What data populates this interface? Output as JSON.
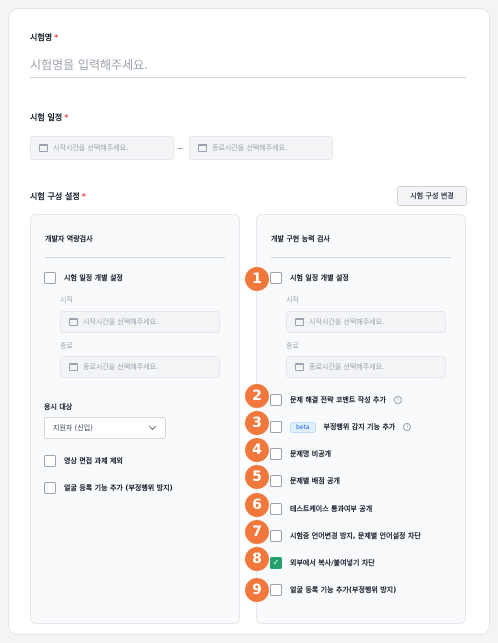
{
  "form": {
    "name_label": "시험명",
    "required_mark": "*",
    "name_placeholder": "시험명을 입력해주세요.",
    "schedule_label": "시험 일정",
    "start_placeholder": "시작시간을 선택해주세요.",
    "range_sep": "~",
    "end_placeholder": "종료시간을 선택해주세요.",
    "config_label": "시험 구성 설정",
    "config_button": "시험 구성 변경"
  },
  "left_panel": {
    "title": "개발자 역량검사",
    "schedule_checkbox": "시험 일정 개별 설정",
    "start_label": "시작",
    "start_placeholder": "시작시간을 선택해주세요.",
    "end_label": "종료",
    "end_placeholder": "종료시간을 선택해주세요.",
    "target_label": "응시 대상",
    "target_value": "지원자 (신입)",
    "options": [
      "영상 면접 과제 제외",
      "얼굴 등록 기능 추가 (부정행위 방지)"
    ]
  },
  "right_panel": {
    "title": "개발 구현 능력 검사",
    "schedule_checkbox": "시험 일정 개별 설정",
    "start_label": "시작",
    "start_placeholder": "시작시간을 선택해주세요.",
    "end_label": "종료",
    "end_placeholder": "종료시간을 선택해주세요.",
    "beta_badge": "beta",
    "options": [
      {
        "label": "문제 해결 전략 코멘트 작성 추가",
        "checked": false
      },
      {
        "label": "부정행위 감지 기능 추가",
        "checked": false
      },
      {
        "label": "문제명 비공개",
        "checked": false
      },
      {
        "label": "문제별 배점 공개",
        "checked": false
      },
      {
        "label": "테스트케이스 통과여부 공개",
        "checked": false
      },
      {
        "label": "시험중 언어변경 방지, 문제별 언어설정 차단",
        "checked": false
      },
      {
        "label": "외부에서 복사/붙여넣기 차단",
        "checked": true
      },
      {
        "label": "얼굴 등록 기능 추가(부정행위 방지)",
        "checked": false
      }
    ]
  },
  "markers": [
    "1",
    "2",
    "3",
    "4",
    "5",
    "6",
    "7",
    "8",
    "9"
  ],
  "colors": {
    "accent": "#22a06b",
    "marker": "#f0783c",
    "required": "#ef4444"
  }
}
